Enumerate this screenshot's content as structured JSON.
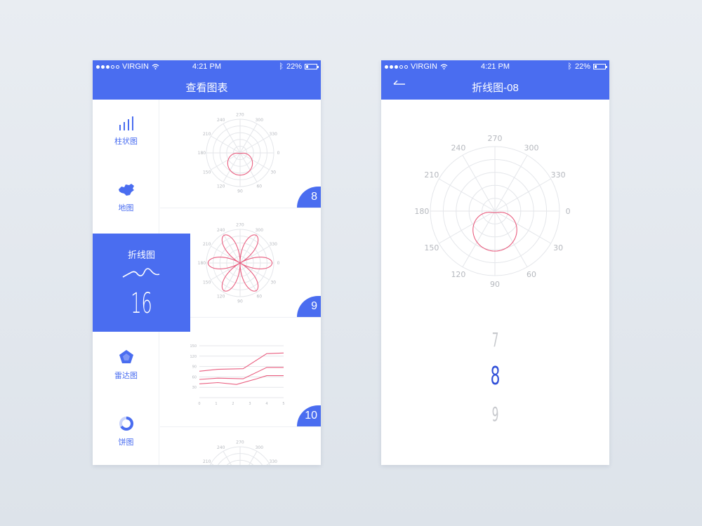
{
  "status": {
    "carrier": "VIRGIN",
    "time": "4:21 PM",
    "battery": "22%",
    "battery_fraction": 0.22
  },
  "left": {
    "title": "查看图表",
    "sidebar": [
      {
        "label": "柱状图",
        "icon": "bar-chart-icon"
      },
      {
        "label": "地图",
        "icon": "china-map-icon"
      },
      {
        "label": "雷达图",
        "icon": "radar-chart-icon"
      },
      {
        "label": "饼图",
        "icon": "pie-chart-icon"
      }
    ],
    "active": {
      "label": "折线图",
      "icon": "line-wave-icon",
      "count": "16"
    },
    "cards": [
      {
        "badge": "8",
        "type": "polar-cardioid"
      },
      {
        "badge": "9",
        "type": "polar-flower"
      },
      {
        "badge": "10",
        "type": "line"
      },
      {
        "badge": "",
        "type": "polar-partial"
      }
    ],
    "polar_ticks": [
      "270",
      "300",
      "330",
      "0",
      "30",
      "60",
      "90",
      "120",
      "150",
      "180",
      "210",
      "240"
    ],
    "line_chart": {
      "y_ticks": [
        "150",
        "120",
        "90",
        "60",
        "30"
      ],
      "x_ticks": [
        "0",
        "1",
        "2",
        "3",
        "4",
        "5"
      ]
    }
  },
  "right": {
    "title": "折线图-08",
    "back_icon": "back-arrow-icon",
    "polar_ticks": [
      "270",
      "300",
      "330",
      "0",
      "30",
      "60",
      "90",
      "120",
      "150",
      "180",
      "210",
      "240"
    ],
    "picker": {
      "prev": "7",
      "current": "8",
      "next": "9"
    }
  },
  "colors": {
    "accent": "#4a6df0",
    "curve": "#e95d7f"
  }
}
